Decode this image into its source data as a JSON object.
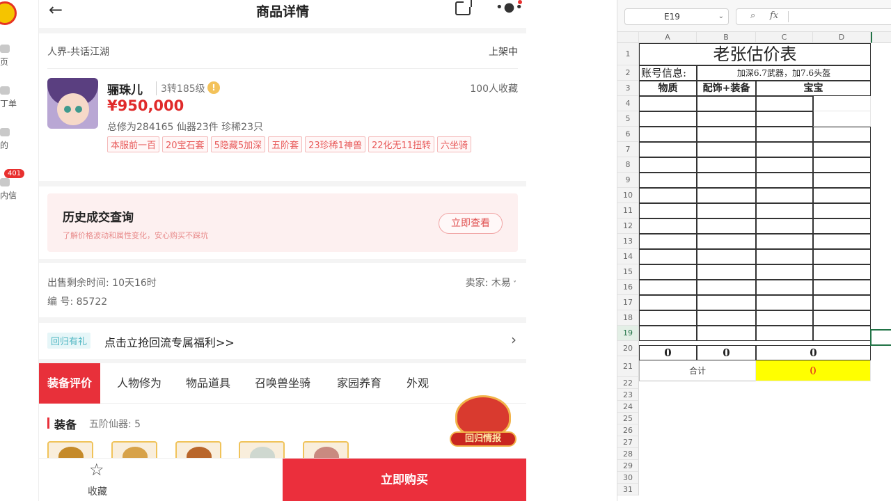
{
  "left_nav": {
    "items": [
      {
        "label": "首页",
        "visible_text": "页"
      },
      {
        "label": "订单",
        "visible_text": "丁单"
      },
      {
        "label": "我的",
        "visible_text": "的"
      },
      {
        "label": "站内信",
        "visible_text": "内信"
      }
    ],
    "badge": "401"
  },
  "phone": {
    "header": {
      "title": "商品详情",
      "back_icon": "arrow-left-icon",
      "share_icon": "share-icon",
      "more_icon": "more-icon"
    },
    "product": {
      "server": "人界-共话江湖",
      "status": "上架中",
      "name": "骊珠儿",
      "level": "3转185级",
      "favorites": "100人收藏",
      "price": "¥950,000",
      "stats": "总修为284165 仙器23件 珍稀23只",
      "tags": [
        "本服前一百",
        "20宝石套",
        "5隐藏5加深",
        "五阶套",
        "23珍稀1神兽",
        "22化无11扭转",
        "六坐骑"
      ]
    },
    "history": {
      "title": "历史成交查询",
      "subtitle": "了解价格波动和属性变化，安心购买不踩坑",
      "button": "立即查看"
    },
    "sale": {
      "remaining": "出售剩余时间: 10天16时",
      "seller": "卖家: 木易",
      "serial": "编 号: 85722"
    },
    "promo": {
      "tag": "回归有礼",
      "text": "点击立抢回流专属福利>>"
    },
    "tabs": [
      "装备评价",
      "人物修为",
      "物品道具",
      "召唤兽坐骑",
      "家园养育",
      "外观"
    ],
    "equipment": {
      "title": "装备",
      "subtitle": "五阶仙器: 5"
    },
    "float_badge": "回归情报",
    "bottom": {
      "collect": "收藏",
      "buy": "立即购买"
    }
  },
  "spreadsheet": {
    "name_box": "E19",
    "columns": [
      "A",
      "B",
      "C",
      "D"
    ],
    "title": "老张估价表",
    "account_label": "账号信息:",
    "account_value": "加深6.7武器，加7.6头盔",
    "headers": [
      "物质",
      "配饰+装备",
      "宝宝"
    ],
    "row20_values": [
      "0",
      "0",
      "0"
    ],
    "total_label": "合计",
    "total_value": "0",
    "highlight_color": "#ffff00",
    "total_text_color": "#e02020",
    "row_numbers": [
      "1",
      "2",
      "3",
      "4",
      "5",
      "6",
      "7",
      "8",
      "9",
      "10",
      "11",
      "12",
      "13",
      "14",
      "15",
      "16",
      "17",
      "18",
      "19",
      "20",
      "21",
      "22",
      "23",
      "24",
      "25",
      "26",
      "27",
      "28",
      "29",
      "30",
      "31"
    ]
  }
}
